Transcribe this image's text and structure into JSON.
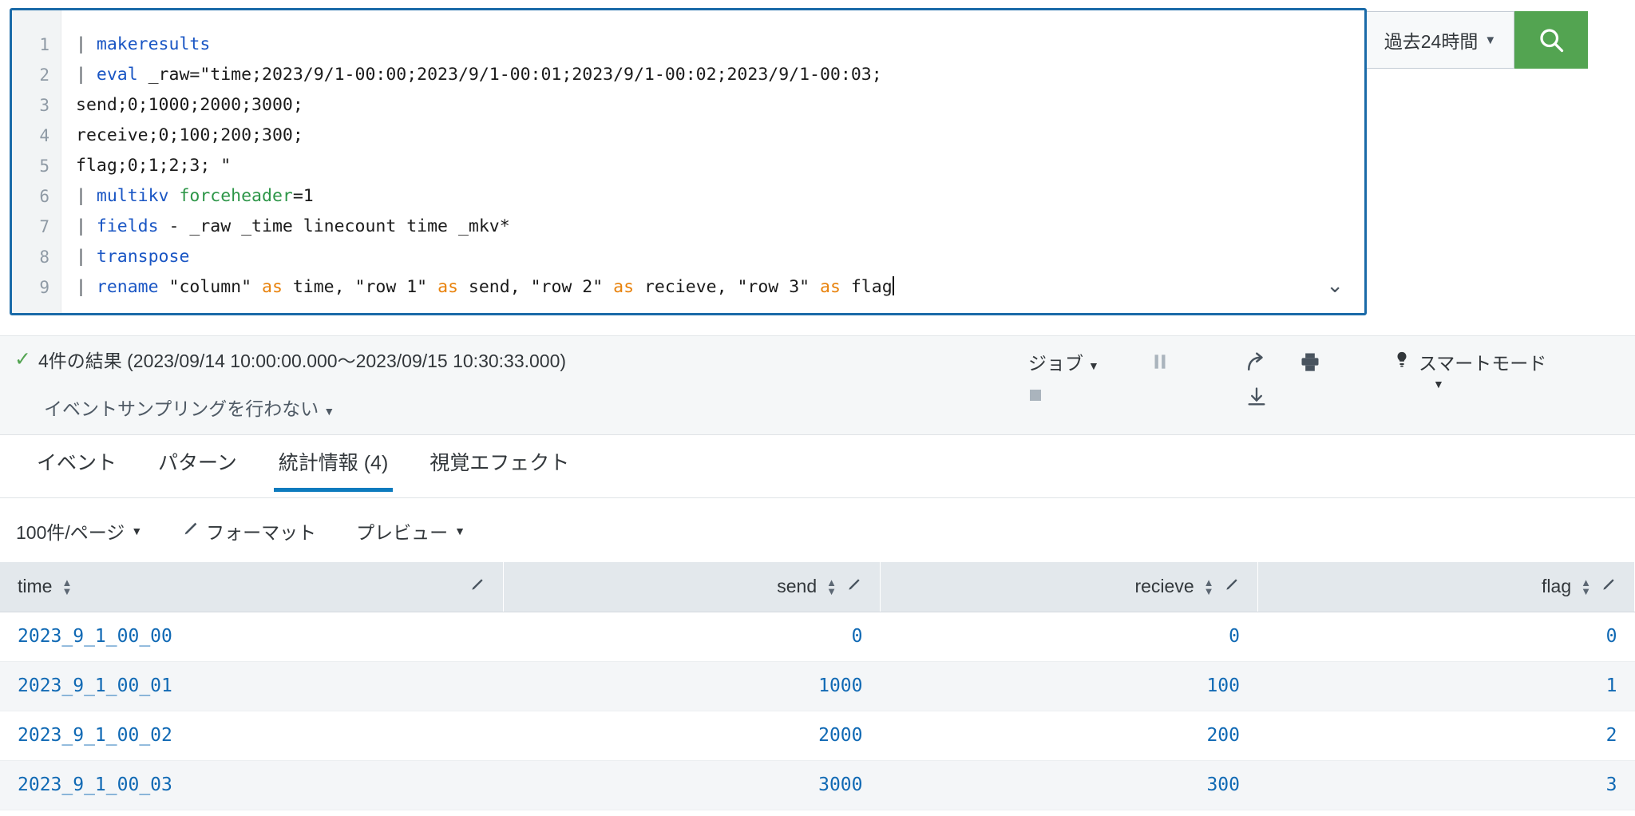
{
  "search": {
    "query_lines": [
      {
        "n": "1",
        "segments": [
          {
            "t": "| ",
            "c": "pipe"
          },
          {
            "t": "makeresults",
            "c": "cmd"
          }
        ]
      },
      {
        "n": "2",
        "segments": [
          {
            "t": "| ",
            "c": "pipe"
          },
          {
            "t": "eval",
            "c": "cmd"
          },
          {
            "t": " _raw=\"time;2023/9/1-00:00;2023/9/1-00:01;2023/9/1-00:02;2023/9/1-00:03;",
            "c": "plain"
          }
        ]
      },
      {
        "n": "3",
        "segments": [
          {
            "t": "send;0;1000;2000;3000;",
            "c": "plain"
          }
        ]
      },
      {
        "n": "4",
        "segments": [
          {
            "t": "receive;0;100;200;300;",
            "c": "plain"
          }
        ]
      },
      {
        "n": "5",
        "segments": [
          {
            "t": "flag;0;1;2;3; \"",
            "c": "plain"
          }
        ]
      },
      {
        "n": "6",
        "segments": [
          {
            "t": "| ",
            "c": "pipe"
          },
          {
            "t": "multikv",
            "c": "cmd"
          },
          {
            "t": " ",
            "c": "plain"
          },
          {
            "t": "forceheader",
            "c": "kwgreen"
          },
          {
            "t": "=1",
            "c": "plain"
          }
        ]
      },
      {
        "n": "7",
        "segments": [
          {
            "t": "| ",
            "c": "pipe"
          },
          {
            "t": "fields",
            "c": "cmd"
          },
          {
            "t": " - _raw _time linecount time _mkv*",
            "c": "plain"
          }
        ]
      },
      {
        "n": "8",
        "segments": [
          {
            "t": "| ",
            "c": "pipe"
          },
          {
            "t": "transpose",
            "c": "cmd"
          }
        ]
      },
      {
        "n": "9",
        "segments": [
          {
            "t": "| ",
            "c": "pipe"
          },
          {
            "t": "rename",
            "c": "cmd"
          },
          {
            "t": " \"column\" ",
            "c": "plain"
          },
          {
            "t": "as",
            "c": "kworange"
          },
          {
            "t": " time, \"row 1\" ",
            "c": "plain"
          },
          {
            "t": "as",
            "c": "kworange"
          },
          {
            "t": " send, \"row 2\" ",
            "c": "plain"
          },
          {
            "t": "as",
            "c": "kworange"
          },
          {
            "t": " recieve, \"row 3\" ",
            "c": "plain"
          },
          {
            "t": "as",
            "c": "kworange"
          },
          {
            "t": " flag",
            "c": "plain"
          }
        ]
      }
    ],
    "time_picker_label": "過去24時間",
    "search_button_icon": "search-icon",
    "editor_collapse_icon": "chevron-down-icon"
  },
  "results_bar": {
    "count_text": "4件の結果 (2023/09/14 10:00:00.000〜2023/09/15 10:30:33.000)",
    "sampling_label": "イベントサンプリングを行わない",
    "jobs_label": "ジョブ",
    "smart_mode_label": "スマートモード",
    "icons": {
      "pause": "pause-icon",
      "stop": "stop-icon",
      "share": "share-icon",
      "print": "print-icon",
      "export": "export-icon",
      "lightbulb": "lightbulb-icon"
    }
  },
  "tabs": [
    {
      "label": "イベント",
      "active": false
    },
    {
      "label": "パターン",
      "active": false
    },
    {
      "label": "統計情報 (4)",
      "active": true
    },
    {
      "label": "視覚エフェクト",
      "active": false
    }
  ],
  "table_toolbar": {
    "per_page_label": "100件/ページ",
    "format_label": "フォーマット",
    "preview_label": "プレビュー"
  },
  "table": {
    "columns": [
      {
        "label": "time",
        "align": "left"
      },
      {
        "label": "send",
        "align": "right"
      },
      {
        "label": "recieve",
        "align": "right"
      },
      {
        "label": "flag",
        "align": "right"
      }
    ],
    "rows": [
      {
        "time": "2023_9_1_00_00",
        "send": "0",
        "recieve": "0",
        "flag": "0"
      },
      {
        "time": "2023_9_1_00_01",
        "send": "1000",
        "recieve": "100",
        "flag": "1"
      },
      {
        "time": "2023_9_1_00_02",
        "send": "2000",
        "recieve": "200",
        "flag": "2"
      },
      {
        "time": "2023_9_1_00_03",
        "send": "3000",
        "recieve": "300",
        "flag": "3"
      }
    ]
  },
  "colors": {
    "accent_blue": "#1a6aa8",
    "search_green": "#53a451",
    "tab_underline": "#0c7bbe",
    "link_blue": "#1069b4"
  }
}
